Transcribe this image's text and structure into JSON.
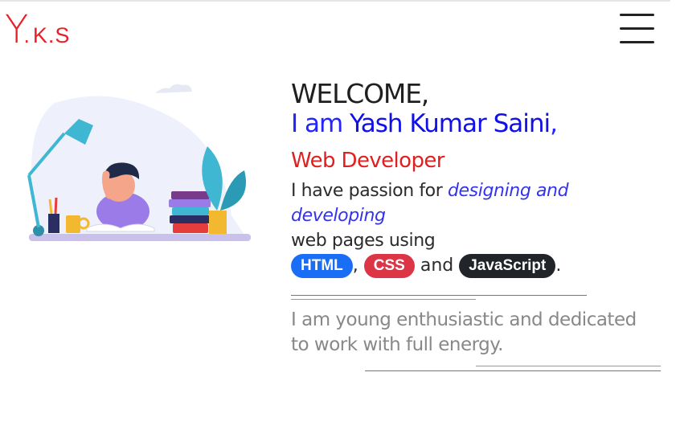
{
  "brand": {
    "initial": "Y.",
    "rest": "K.S",
    "color": "#e8202a"
  },
  "menu": {
    "icon": "hamburger-icon"
  },
  "illustration": {
    "icon": "person-reading-at-desk-illustration"
  },
  "hero": {
    "greeting": "WELCOME,",
    "intro_prefix": "I am ",
    "name": "Yash Kumar Saini",
    "intro_suffix": ",",
    "role": "Web Developer",
    "passion_prefix": "I have passion for ",
    "passion_em1": "designing and",
    "passion_em2": "developing",
    "passion_line3": "web pages using",
    "skills": [
      "HTML",
      "CSS",
      "JavaScript"
    ],
    "comma": ",",
    "and_word": " and ",
    "period": ".",
    "tagline_1": "I am young enthusiastic and dedicated",
    "tagline_2": "to work with full energy."
  },
  "colors": {
    "html": "#1a6ef5",
    "css": "#dc3545",
    "js": "#212529",
    "name": "#1010e8",
    "role": "#e02020"
  }
}
